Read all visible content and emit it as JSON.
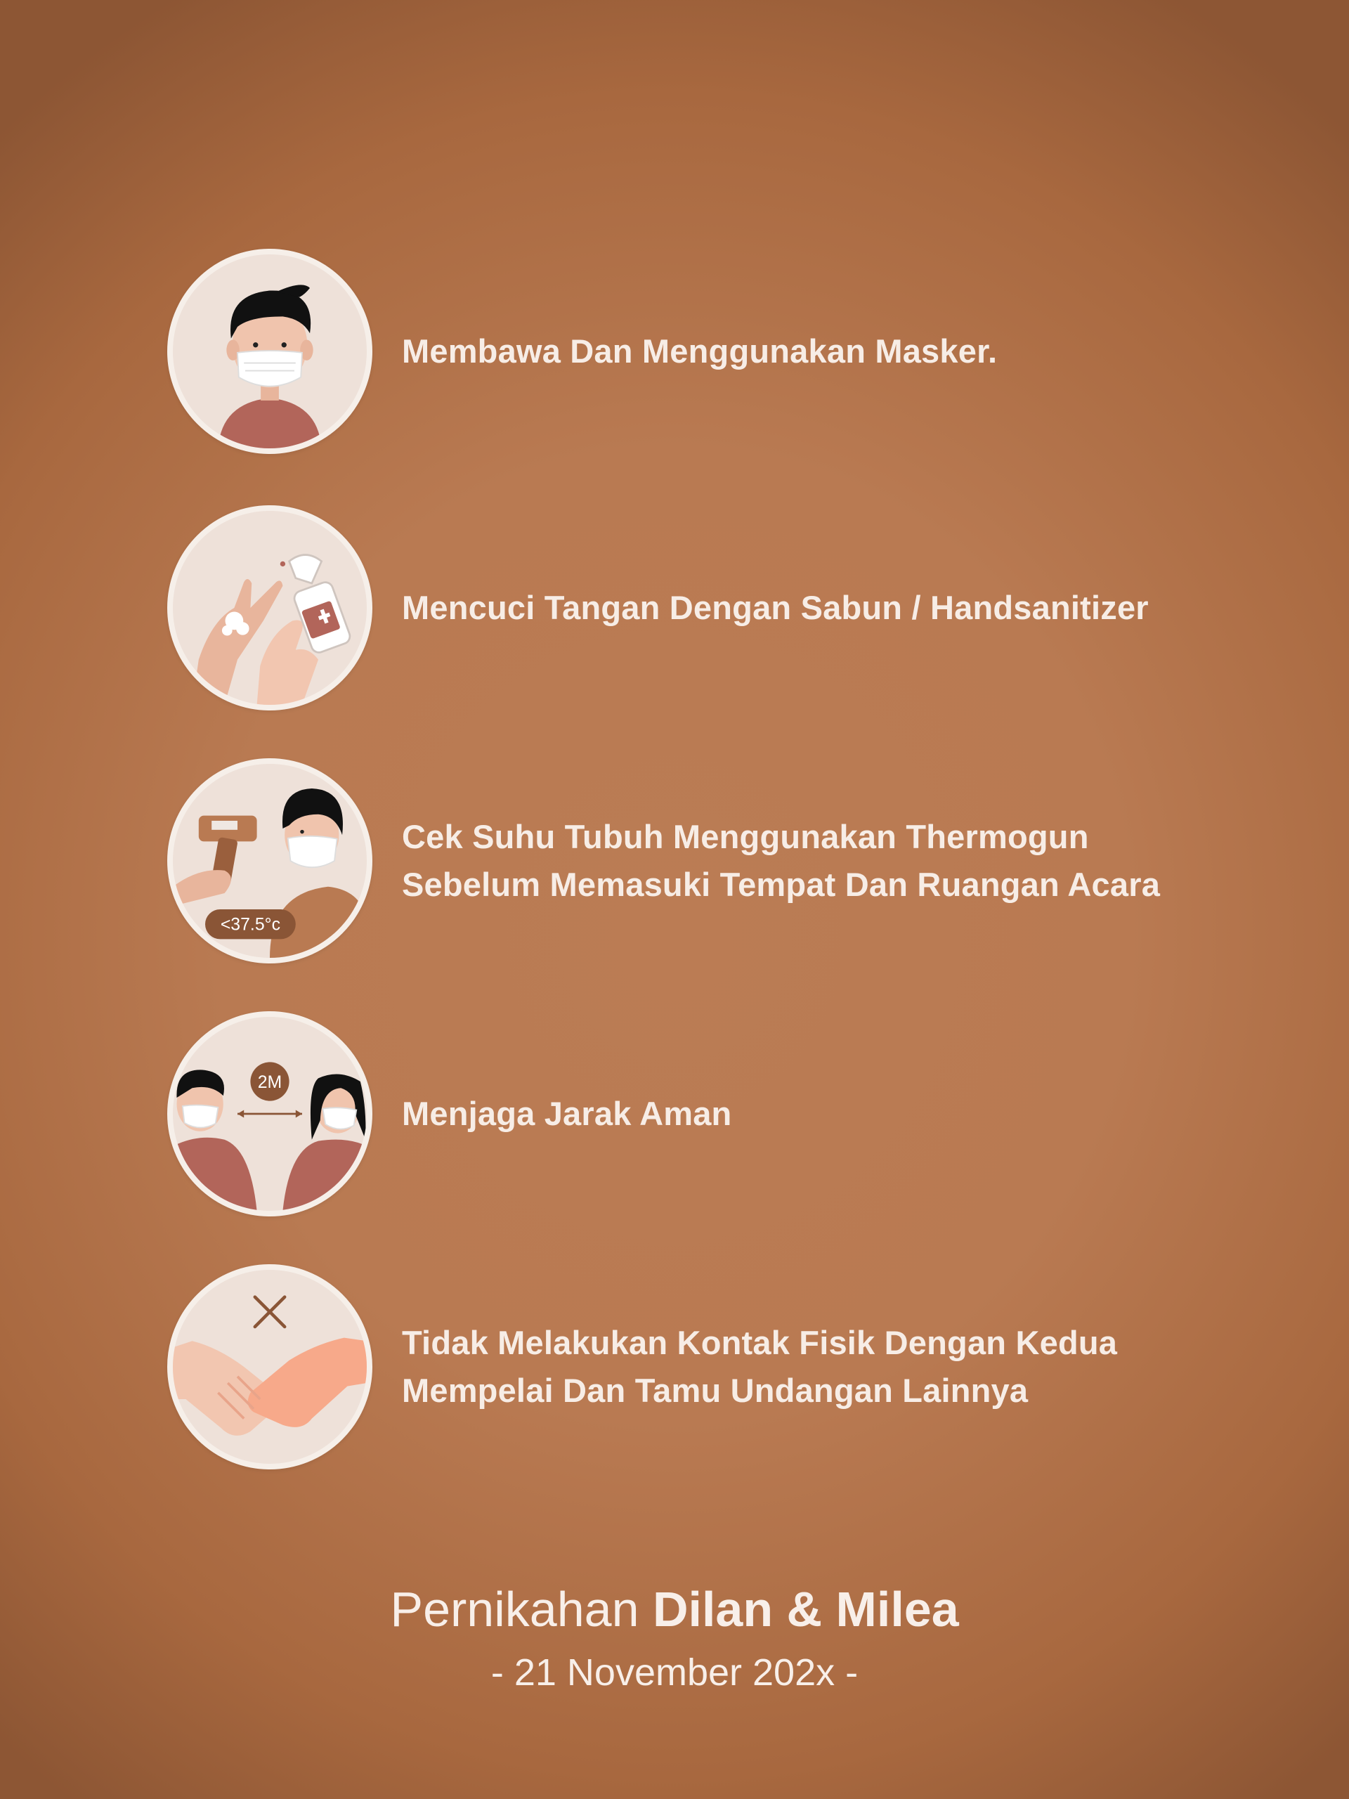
{
  "rules": [
    {
      "lines": [
        "Membawa Dan Menggunakan Masker."
      ],
      "icon": "mask-person-icon"
    },
    {
      "lines": [
        "Mencuci Tangan Dengan Sabun / Handsanitizer"
      ],
      "icon": "handwash-sanitizer-icon"
    },
    {
      "lines": [
        "Cek Suhu Tubuh Menggunakan Thermogun",
        "Sebelum Memasuki Tempat Dan Ruangan Acara"
      ],
      "icon": "thermogun-icon",
      "badge": "<37.5°c"
    },
    {
      "lines": [
        "Menjaga Jarak Aman"
      ],
      "icon": "social-distance-icon",
      "badge": "2M"
    },
    {
      "lines": [
        "Tidak Melakukan Kontak Fisik Dengan Kedua",
        "Mempelai Dan Tamu Undangan Lainnya"
      ],
      "icon": "no-handshake-icon"
    }
  ],
  "footer": {
    "title_prefix": "Pernikahan",
    "title_names": "Dilan & Milea",
    "date": "- 21 November 202x -"
  },
  "colors": {
    "background": "#b97a52",
    "circle": "#eee1d9",
    "shirt": "#b2655a",
    "skin": "#e8b59c",
    "text": "#f7ede6",
    "badge": "#8a5536"
  }
}
